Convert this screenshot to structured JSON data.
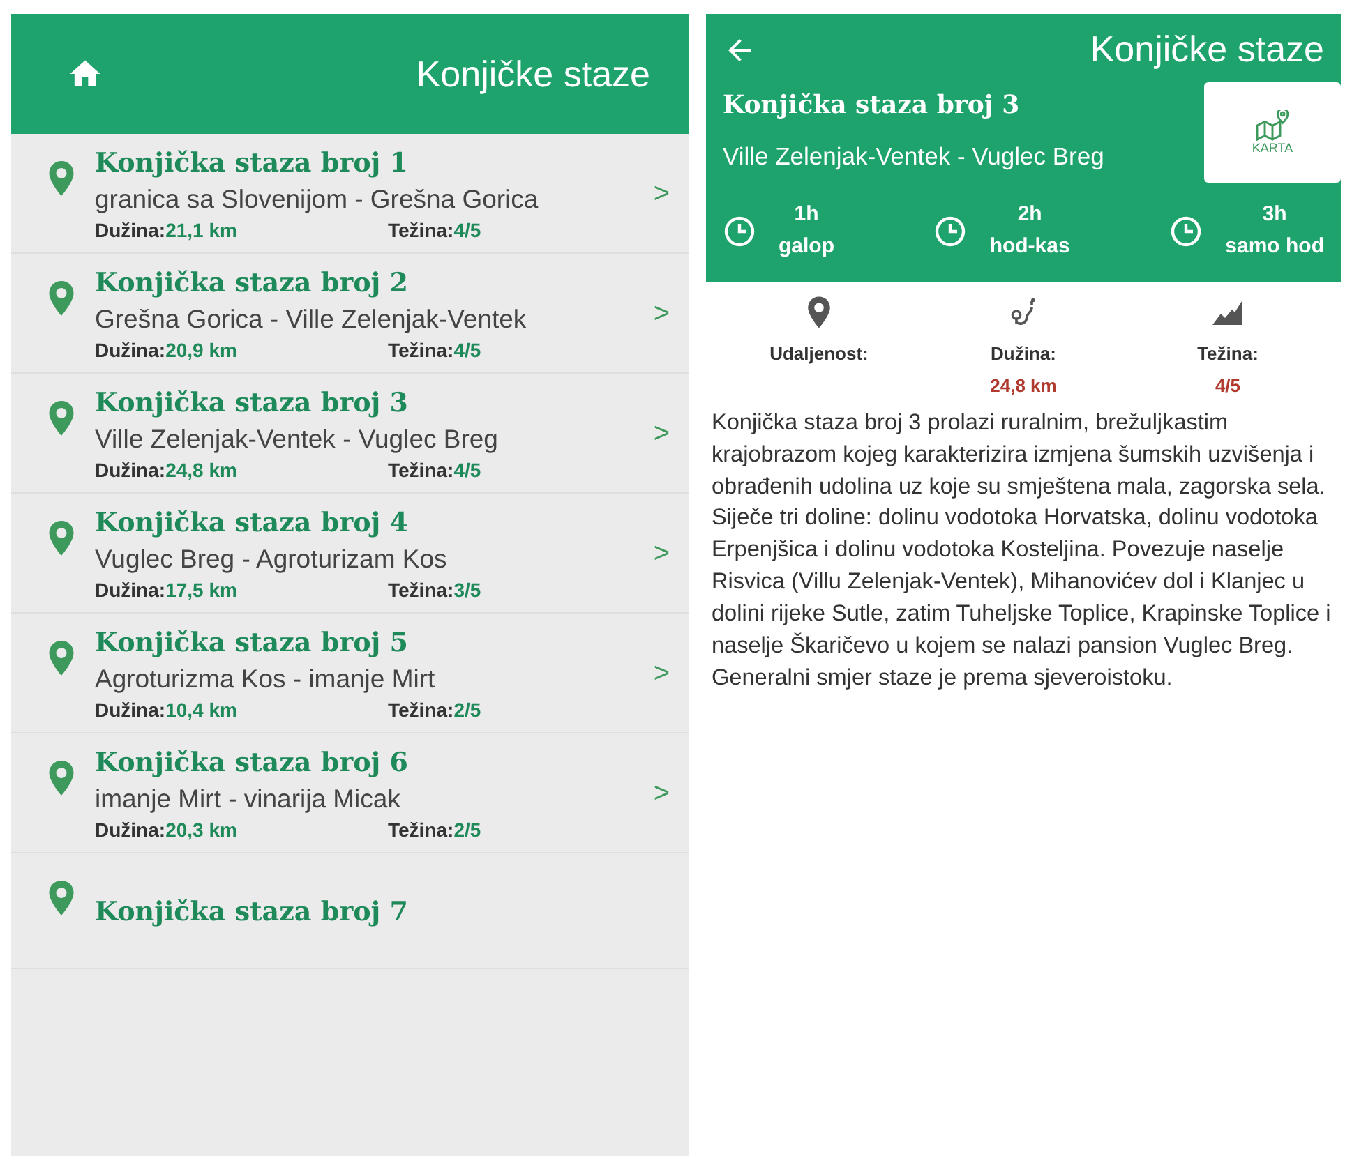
{
  "list_screen": {
    "header": {
      "title": "Konjičke staze"
    },
    "items": [
      {
        "title": "Konjička staza broj 1",
        "route": "granica sa Slovenijom - Grešna Gorica",
        "length_label": "Dužina:",
        "length": "21,1 km",
        "difficulty_label": "Težina:",
        "difficulty": "4/5",
        "chevron": ">"
      },
      {
        "title": "Konjička staza broj 2",
        "route": "Grešna Gorica - Ville Zelenjak-Ventek",
        "length_label": "Dužina:",
        "length": "20,9 km",
        "difficulty_label": "Težina:",
        "difficulty": "4/5",
        "chevron": ">"
      },
      {
        "title": "Konjička staza broj 3",
        "route": "Ville Zelenjak-Ventek - Vuglec Breg",
        "length_label": "Dužina:",
        "length": "24,8 km",
        "difficulty_label": "Težina:",
        "difficulty": "4/5",
        "chevron": ">"
      },
      {
        "title": "Konjička staza broj 4",
        "route": "Vuglec Breg - Agroturizam Kos",
        "length_label": "Dužina:",
        "length": "17,5 km",
        "difficulty_label": "Težina:",
        "difficulty": "3/5",
        "chevron": ">"
      },
      {
        "title": "Konjička staza broj 5",
        "route": "Agroturizma Kos - imanje Mirt",
        "length_label": "Dužina:",
        "length": "10,4 km",
        "difficulty_label": "Težina:",
        "difficulty": "2/5",
        "chevron": ">"
      },
      {
        "title": "Konjička staza broj 6",
        "route": "imanje Mirt -  vinarija Micak",
        "length_label": "Dužina:",
        "length": "20,3 km",
        "difficulty_label": "Težina:",
        "difficulty": "2/5",
        "chevron": ">"
      },
      {
        "title": "Konjička staza broj 7"
      }
    ]
  },
  "detail_screen": {
    "header": {
      "title": "Konjičke staze"
    },
    "trail_title": "Konjička staza broj 3",
    "route": "Ville Zelenjak-Ventek - Vuglec Breg",
    "map_button": "KARTA",
    "durations": [
      {
        "time": "1h",
        "mode": "galop"
      },
      {
        "time": "2h",
        "mode": "hod-kas"
      },
      {
        "time": "3h",
        "mode": "samo hod"
      }
    ],
    "stats": [
      {
        "kind": "distance",
        "label": "Udaljenost:"
      },
      {
        "kind": "length",
        "label": "Dužina:",
        "value": "24,8 km"
      },
      {
        "kind": "difficulty",
        "label": "Težina:",
        "value": "4/5"
      }
    ],
    "description": "Konjička staza broj 3 prolazi ruralnim, brežuljkastim krajobrazom kojeg karakterizira izmjena šumskih uzvišenja i obrađenih udolina uz koje su smještena mala, zagorska sela. Siječe tri doline: dolinu vodotoka Horvatska, dolinu vodotoka Erpenjšica i dolinu vodotoka Kosteljina. Povezuje naselje Risvica (Villu Zelenjak-Ventek), Mihanovićev dol i Klanjec u dolini rijeke Sutle, zatim Tuheljske Toplice, Krapinske Toplice i naselje Škaričevo u kojem se nalazi pansion Vuglec Breg. Generalni smjer staze je prema sjeveroistoku."
  }
}
